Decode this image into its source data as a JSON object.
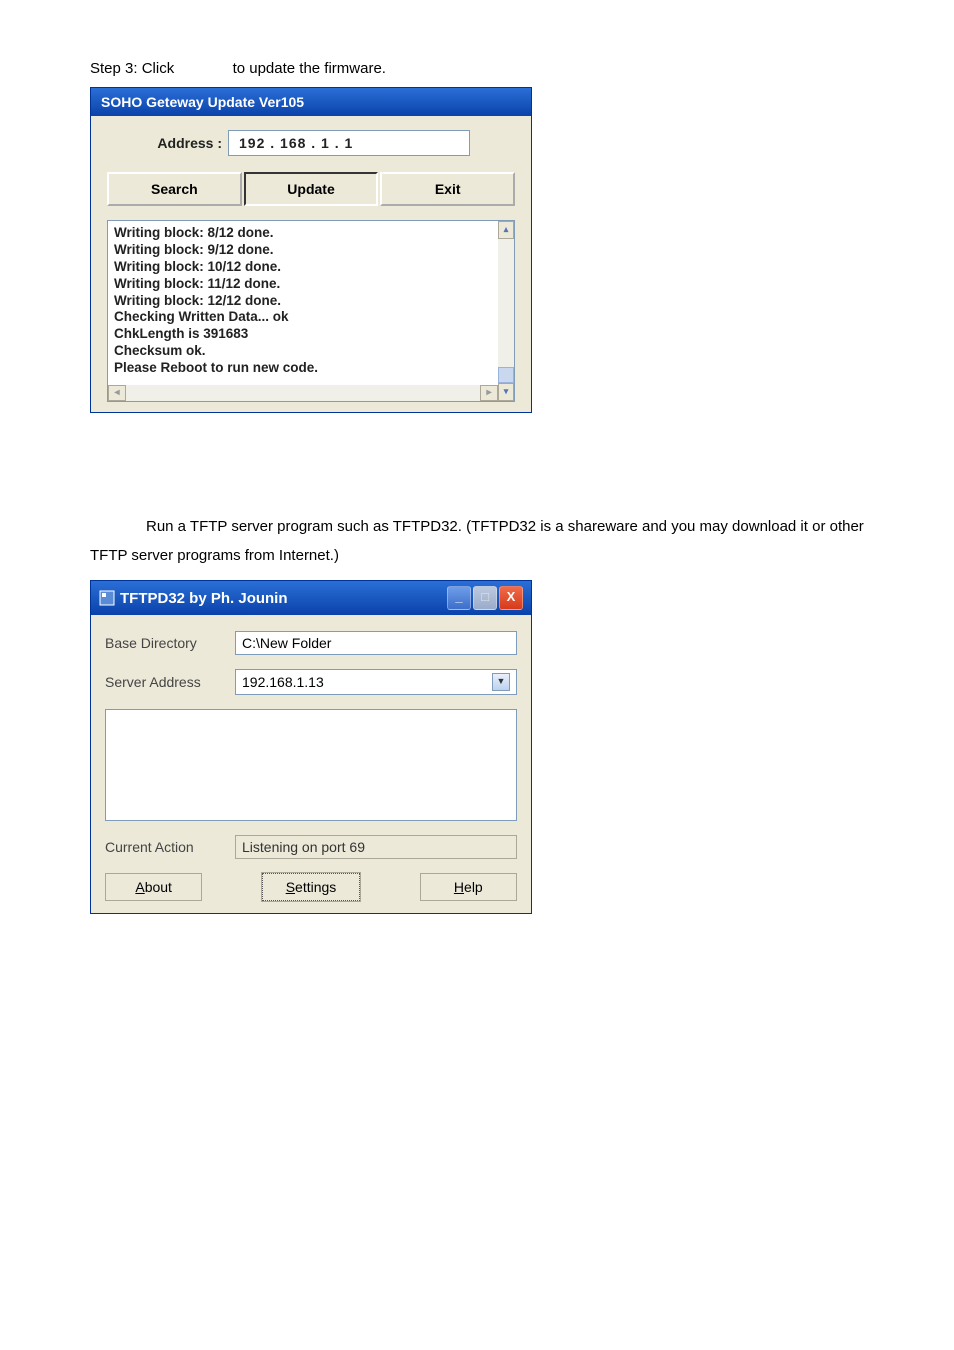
{
  "step3_text_pre": "Step 3: Click",
  "step3_text_post": "to update the firmware.",
  "soho": {
    "title": "SOHO Geteway Update Ver105",
    "address_label": "Address :",
    "ip": "192  .  168   .    1    .    1",
    "btn_search": "Search",
    "btn_update": "Update",
    "btn_exit": "Exit",
    "log": [
      "Writing block: 8/12 done.",
      "Writing block: 9/12 done.",
      "Writing block: 10/12 done.",
      "Writing block: 11/12 done.",
      "Writing block: 12/12 done.",
      "Checking Written Data... ok",
      "ChkLength is 391683",
      "Checksum ok.",
      "Please Reboot to run new code."
    ]
  },
  "paragraph": "Run a TFTP server program such as TFTPD32. (TFTPD32 is a shareware and you may download it or other TFTP server programs from Internet.)",
  "tftp": {
    "title": "TFTPD32 by Ph. Jounin",
    "base_dir_label": "Base Directory",
    "base_dir_value": "C:\\New Folder",
    "server_addr_label": "Server Address",
    "server_addr_value": "192.168.1.13",
    "current_action_label": "Current Action",
    "current_action_value": "Listening on port 69",
    "btn_about": "About",
    "btn_about_ul": "A",
    "btn_settings": "Settings",
    "btn_settings_ul": "S",
    "btn_help": "Help",
    "btn_help_ul": "H"
  }
}
